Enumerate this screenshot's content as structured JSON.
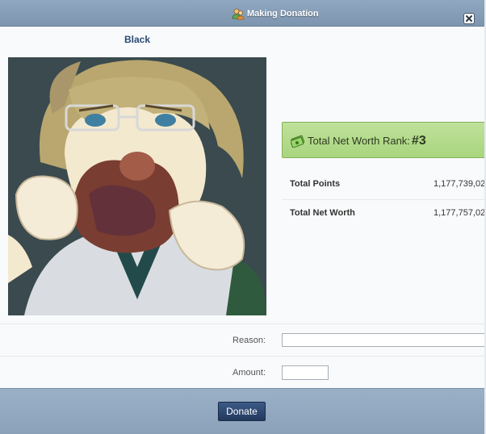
{
  "window": {
    "title": "Making Donation",
    "close_icon": "close-icon"
  },
  "recipient": {
    "username": "Black",
    "avatar_description": "anime character avatar"
  },
  "stats": {
    "rank_label": "Total Net Worth Rank:",
    "rank_value": "#3",
    "rank_icon": "money-icon",
    "rows": [
      {
        "label": "Total Points",
        "value": "1,177,739,02"
      },
      {
        "label": "Total Net Worth",
        "value": "1,177,757,02"
      }
    ]
  },
  "form": {
    "reason_label": "Reason:",
    "reason_value": "",
    "amount_label": "Amount:",
    "amount_value": ""
  },
  "footer": {
    "donate_label": "Donate"
  },
  "colors": {
    "titlebar": "#8fa7c0",
    "rank_bar": "#b4db8a",
    "button": "#2c4670",
    "username": "#2b4a77"
  }
}
